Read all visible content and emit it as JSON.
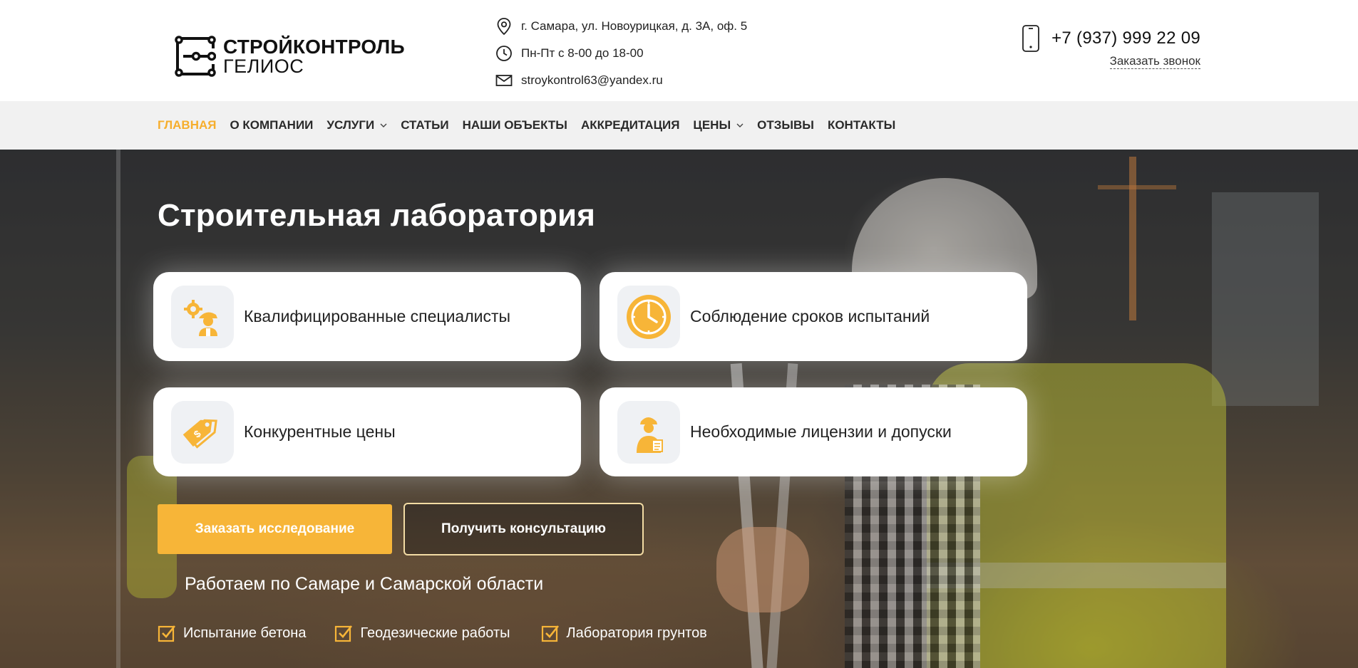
{
  "brand": {
    "line1": "СТРОЙКОНТРОЛЬ",
    "line2": "ГЕЛИОС"
  },
  "contacts": {
    "address": "г. Самара, ул. Новоурицкая, д. 3А, оф. 5",
    "hours": "Пн-Пт с 8-00 до 18-00",
    "email": "stroykontrol63@yandex.ru"
  },
  "phone": {
    "number": "+7 (937) 999 22 09",
    "callback_label": "Заказать звонок"
  },
  "nav": {
    "items": [
      {
        "label": "ГЛАВНАЯ",
        "active": true
      },
      {
        "label": "О КОМПАНИИ"
      },
      {
        "label": "УСЛУГИ",
        "dropdown": true
      },
      {
        "label": "СТАТЬИ"
      },
      {
        "label": "НАШИ ОБЪЕКТЫ"
      },
      {
        "label": "АККРЕДИТАЦИЯ"
      },
      {
        "label": "ЦЕНЫ",
        "dropdown": true
      },
      {
        "label": "ОТЗЫВЫ"
      },
      {
        "label": "КОНТАКТЫ"
      }
    ]
  },
  "hero": {
    "title": "Строительная лаборатория",
    "features": [
      {
        "label": "Квалифицированные специалисты",
        "icon": "specialist-gear-icon"
      },
      {
        "label": "Соблюдение сроков испытаний",
        "icon": "clock-icon"
      },
      {
        "label": "Конкурентные цены",
        "icon": "price-tag-icon"
      },
      {
        "label": "Необходимые лицензии и допуски",
        "icon": "licensed-worker-icon"
      }
    ],
    "primary_button": "Заказать исследование",
    "secondary_button": "Получить консультацию",
    "region": "Работаем по Самаре и Самарской области",
    "checks": [
      "Испытание бетона",
      "Геодезические работы",
      "Лаборатория грунтов"
    ]
  },
  "colors": {
    "accent": "#f6ae2d",
    "button": "#f7b538",
    "nav_bg": "#f1f1f1",
    "card_icon_bg": "#eff1f4"
  }
}
